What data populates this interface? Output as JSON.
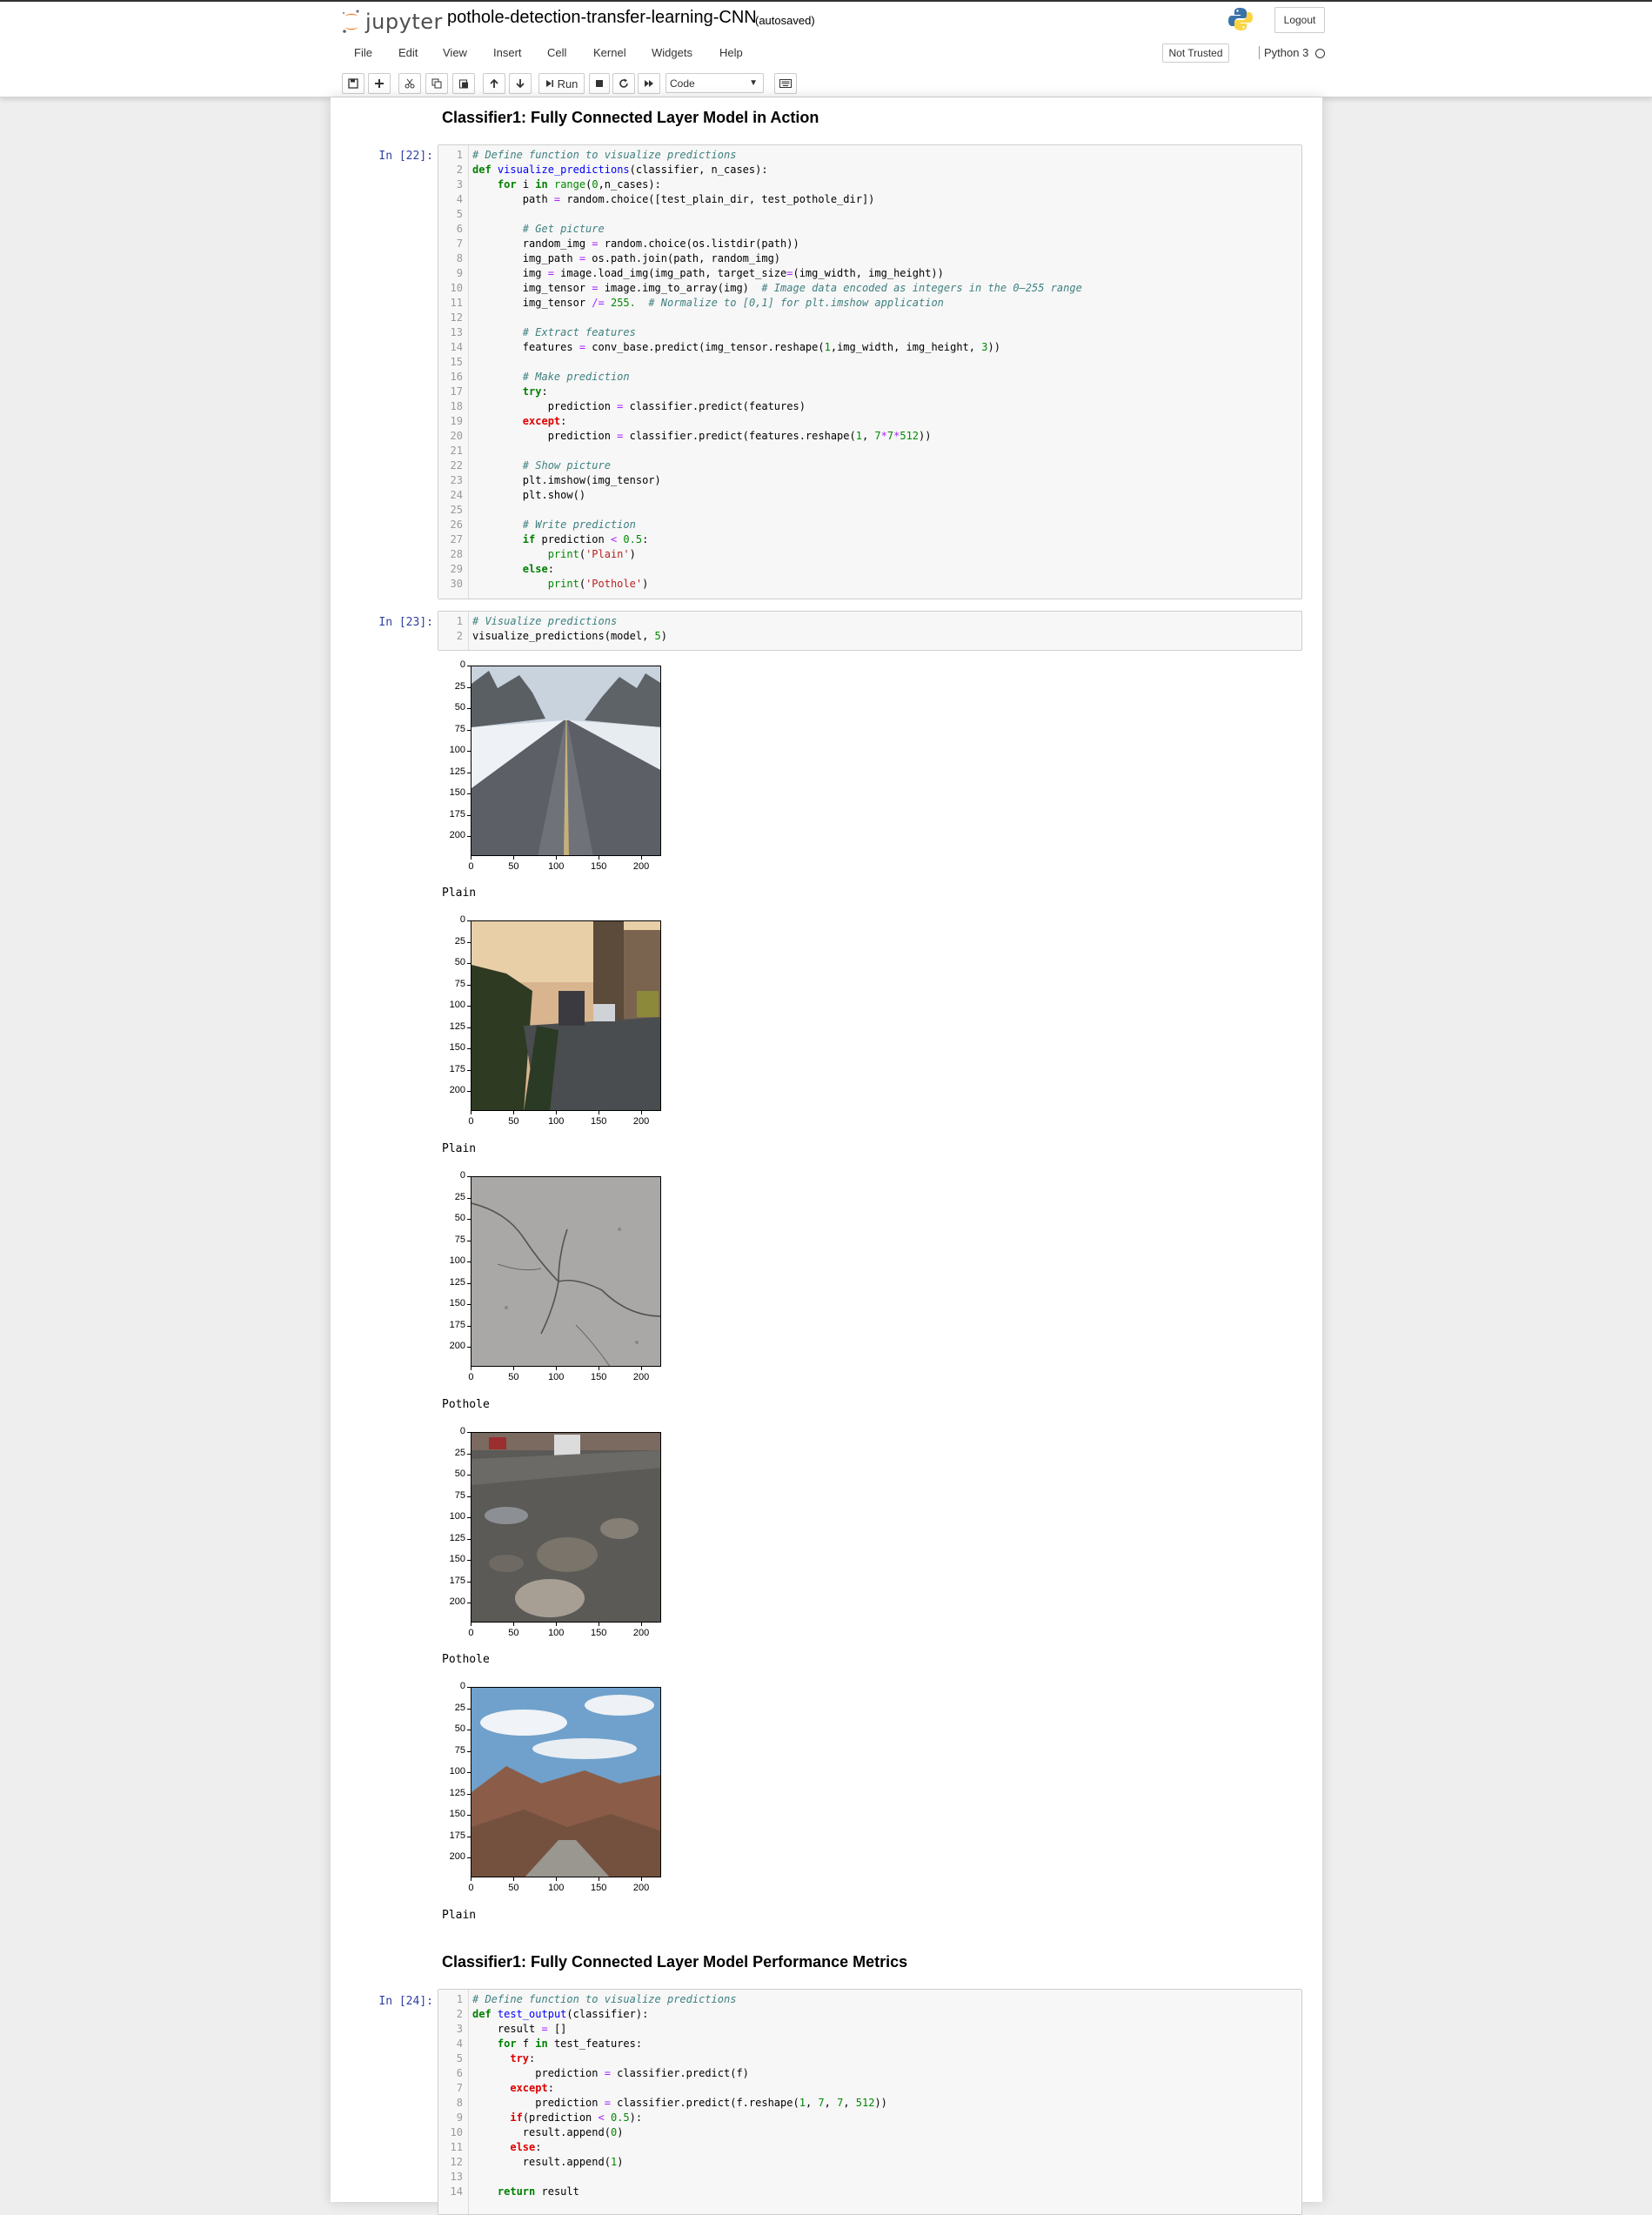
{
  "header": {
    "logo_text": "jupyter",
    "notebook_name": "pothole-detection-transfer-learning-CNN",
    "autosave": "(autosaved)",
    "logout_label": "Logout"
  },
  "menu": [
    "File",
    "Edit",
    "View",
    "Insert",
    "Cell",
    "Kernel",
    "Widgets",
    "Help"
  ],
  "status": {
    "trust": "Not Trusted",
    "kernel": "Python 3"
  },
  "toolbar": {
    "run_label": "Run",
    "cell_type": "Code"
  },
  "headings": {
    "h1": "Classifier1: Fully Connected Layer Model in Action",
    "h2": "Classifier1: Fully Connected Layer Model Performance Metrics"
  },
  "cells": {
    "c22": {
      "prompt": "In [22]:",
      "lines": [
        "# Define function to visualize predictions",
        "def visualize_predictions(classifier, n_cases):",
        "    for i in range(0,n_cases):",
        "        path = random.choice([test_plain_dir, test_pothole_dir])",
        "",
        "        # Get picture",
        "        random_img = random.choice(os.listdir(path))",
        "        img_path = os.path.join(path, random_img)",
        "        img = image.load_img(img_path, target_size=(img_width, img_height))",
        "        img_tensor = image.img_to_array(img)  # Image data encoded as integers in the 0–255 range",
        "        img_tensor /= 255.  # Normalize to [0,1] for plt.imshow application",
        "",
        "        # Extract features",
        "        features = conv_base.predict(img_tensor.reshape(1,img_width, img_height, 3))",
        "",
        "        # Make prediction",
        "        try:",
        "            prediction = classifier.predict(features)",
        "        except:",
        "            prediction = classifier.predict(features.reshape(1, 7*7*512))",
        "",
        "        # Show picture",
        "        plt.imshow(img_tensor)",
        "        plt.show()",
        "",
        "        # Write prediction",
        "        if prediction < 0.5:",
        "            print('Plain')",
        "        else:",
        "            print('Pothole')"
      ]
    },
    "c23": {
      "prompt": "In [23]:",
      "lines": [
        "# Visualize predictions",
        "visualize_predictions(model, 5)"
      ]
    },
    "c24": {
      "prompt": "In [24]:",
      "lines": [
        "# Define function to visualize predictions",
        "def test_output(classifier):",
        "    result = []",
        "    for f in test_features:",
        "      try:",
        "          prediction = classifier.predict(f)",
        "      except:",
        "          prediction = classifier.predict(f.reshape(1, 7, 7, 512))",
        "      if(prediction < 0.5):",
        "        result.append(0)",
        "      else:",
        "        result.append(1)",
        "",
        "    return result"
      ]
    }
  },
  "outputs": {
    "yticks": [
      "0",
      "25",
      "50",
      "75",
      "100",
      "125",
      "150",
      "175",
      "200"
    ],
    "xticks": [
      "0",
      "50",
      "100",
      "150",
      "200"
    ],
    "predictions": [
      "Plain",
      "Plain",
      "Pothole",
      "Pothole",
      "Plain"
    ],
    "scenes": [
      "snowy-road",
      "city-street-sunset",
      "cracked-asphalt",
      "potholes-with-cars",
      "mountain-road"
    ]
  }
}
